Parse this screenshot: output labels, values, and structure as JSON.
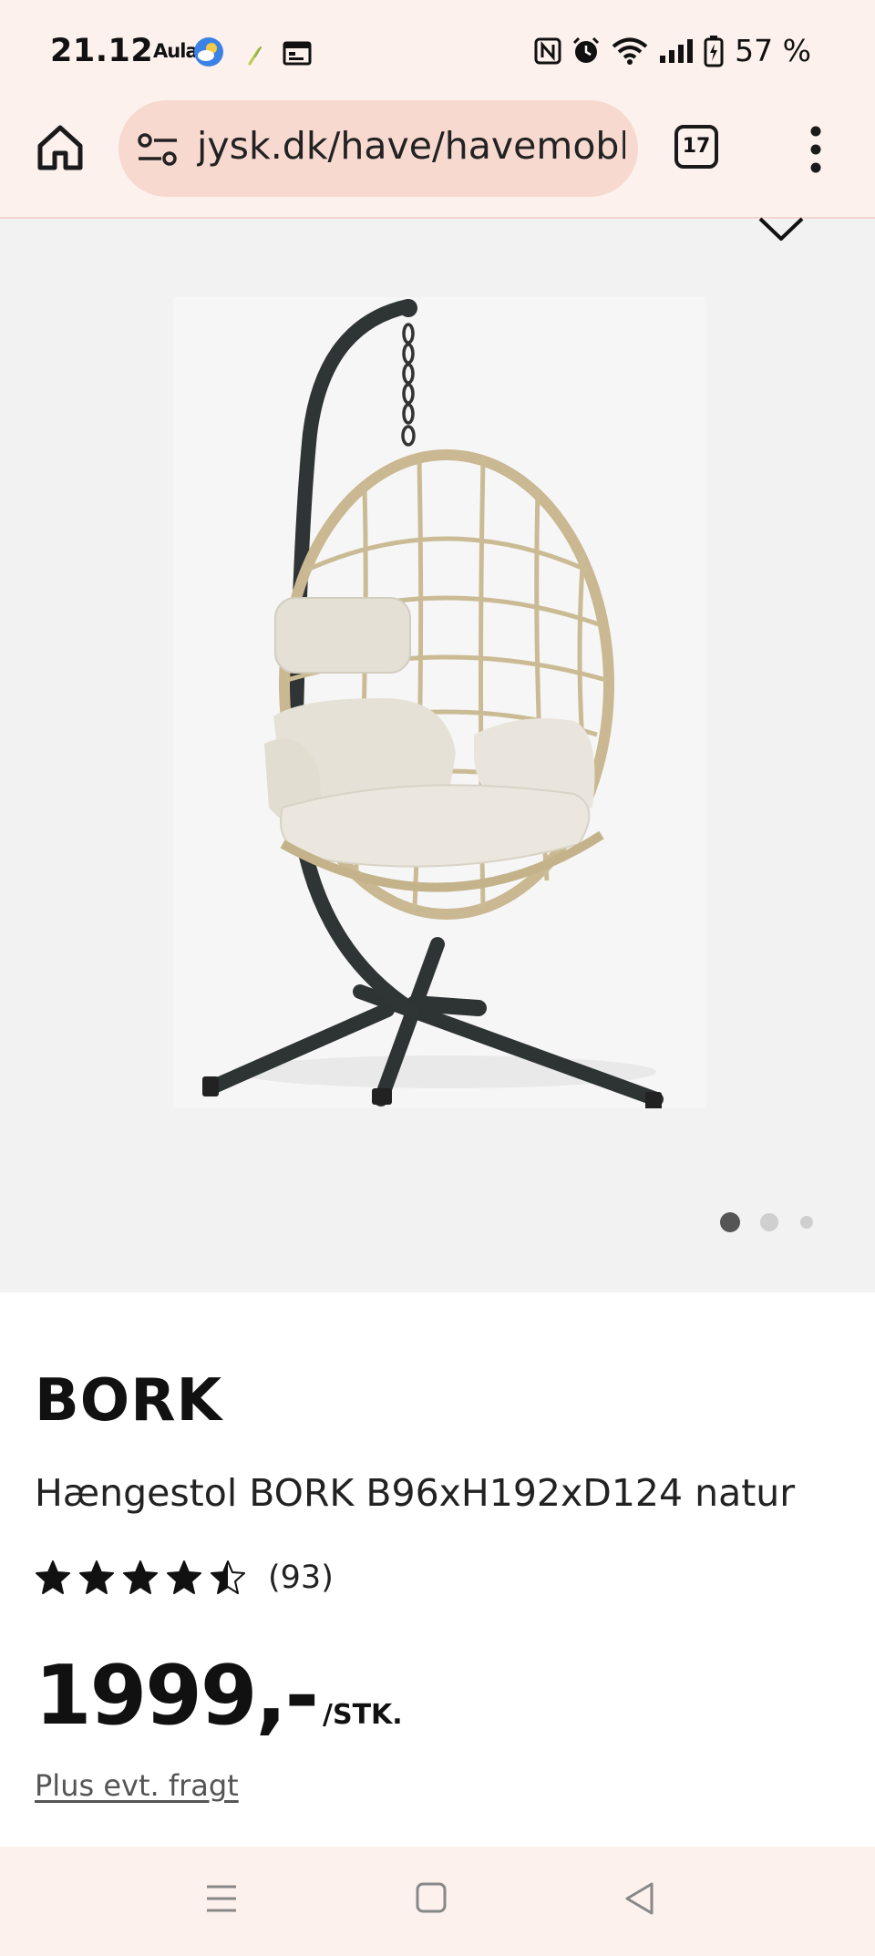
{
  "status_bar": {
    "time": "21.12",
    "aula_label": "Aula",
    "battery_percent": "57 %",
    "icons": [
      "weather-icon",
      "leaf-icon",
      "calendar-icon",
      "nfc-icon",
      "alarm-icon",
      "wifi-icon",
      "signal-icon",
      "battery-charging-icon"
    ]
  },
  "browser": {
    "url": "jysk.dk/have/havemobler/haengestole",
    "tab_count": "17",
    "icons": [
      "home-icon",
      "site-settings-icon",
      "more-vert-icon"
    ]
  },
  "gallery": {
    "image_count": 3,
    "active_index": 0,
    "wishlist_icon": "heart-icon"
  },
  "product": {
    "brand": "BORK",
    "name": "Hængestol BORK B96xH192xD124 natur",
    "rating": 4.5,
    "rating_max": 5,
    "review_count": "(93)",
    "price": "1999,-",
    "unit": "/STK.",
    "shipping_note": "Plus evt. fragt"
  },
  "nav_bar": {
    "icons": [
      "recents-icon",
      "home-square-icon",
      "back-icon"
    ]
  },
  "colors": {
    "chrome_bg": "#fdf1ee",
    "url_pill": "#f7d9d0",
    "hero_bg": "#f2f2f2",
    "text": "#111111"
  }
}
